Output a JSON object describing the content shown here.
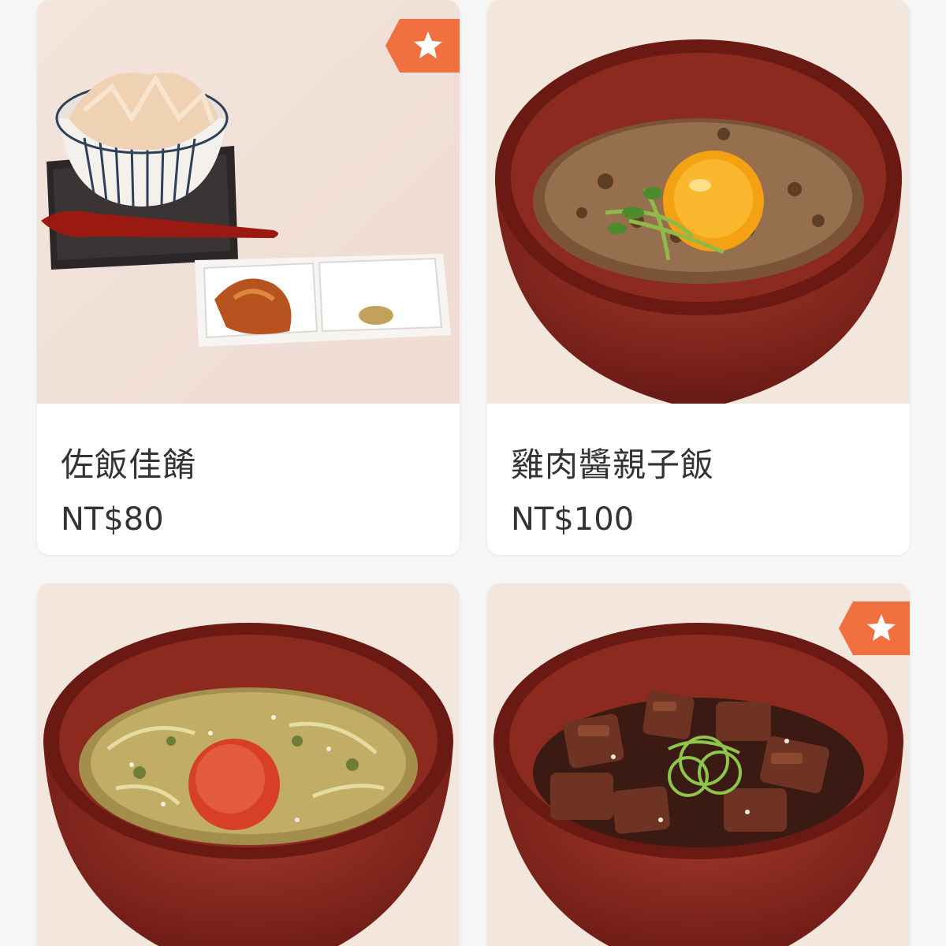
{
  "colors": {
    "background": "#f6f6f6",
    "card": "#ffffff",
    "text": "#333333",
    "badge": "#f0703f"
  },
  "items": [
    {
      "name": "佐飯佳餚",
      "price": "NT$80",
      "recommended": true,
      "badge_icon": "star-icon"
    },
    {
      "name": "雞肉醬親子飯",
      "price": "NT$100",
      "recommended": false
    },
    {
      "name": "",
      "price": "",
      "recommended": false
    },
    {
      "name": "",
      "price": "",
      "recommended": true,
      "badge_icon": "star-icon"
    }
  ]
}
